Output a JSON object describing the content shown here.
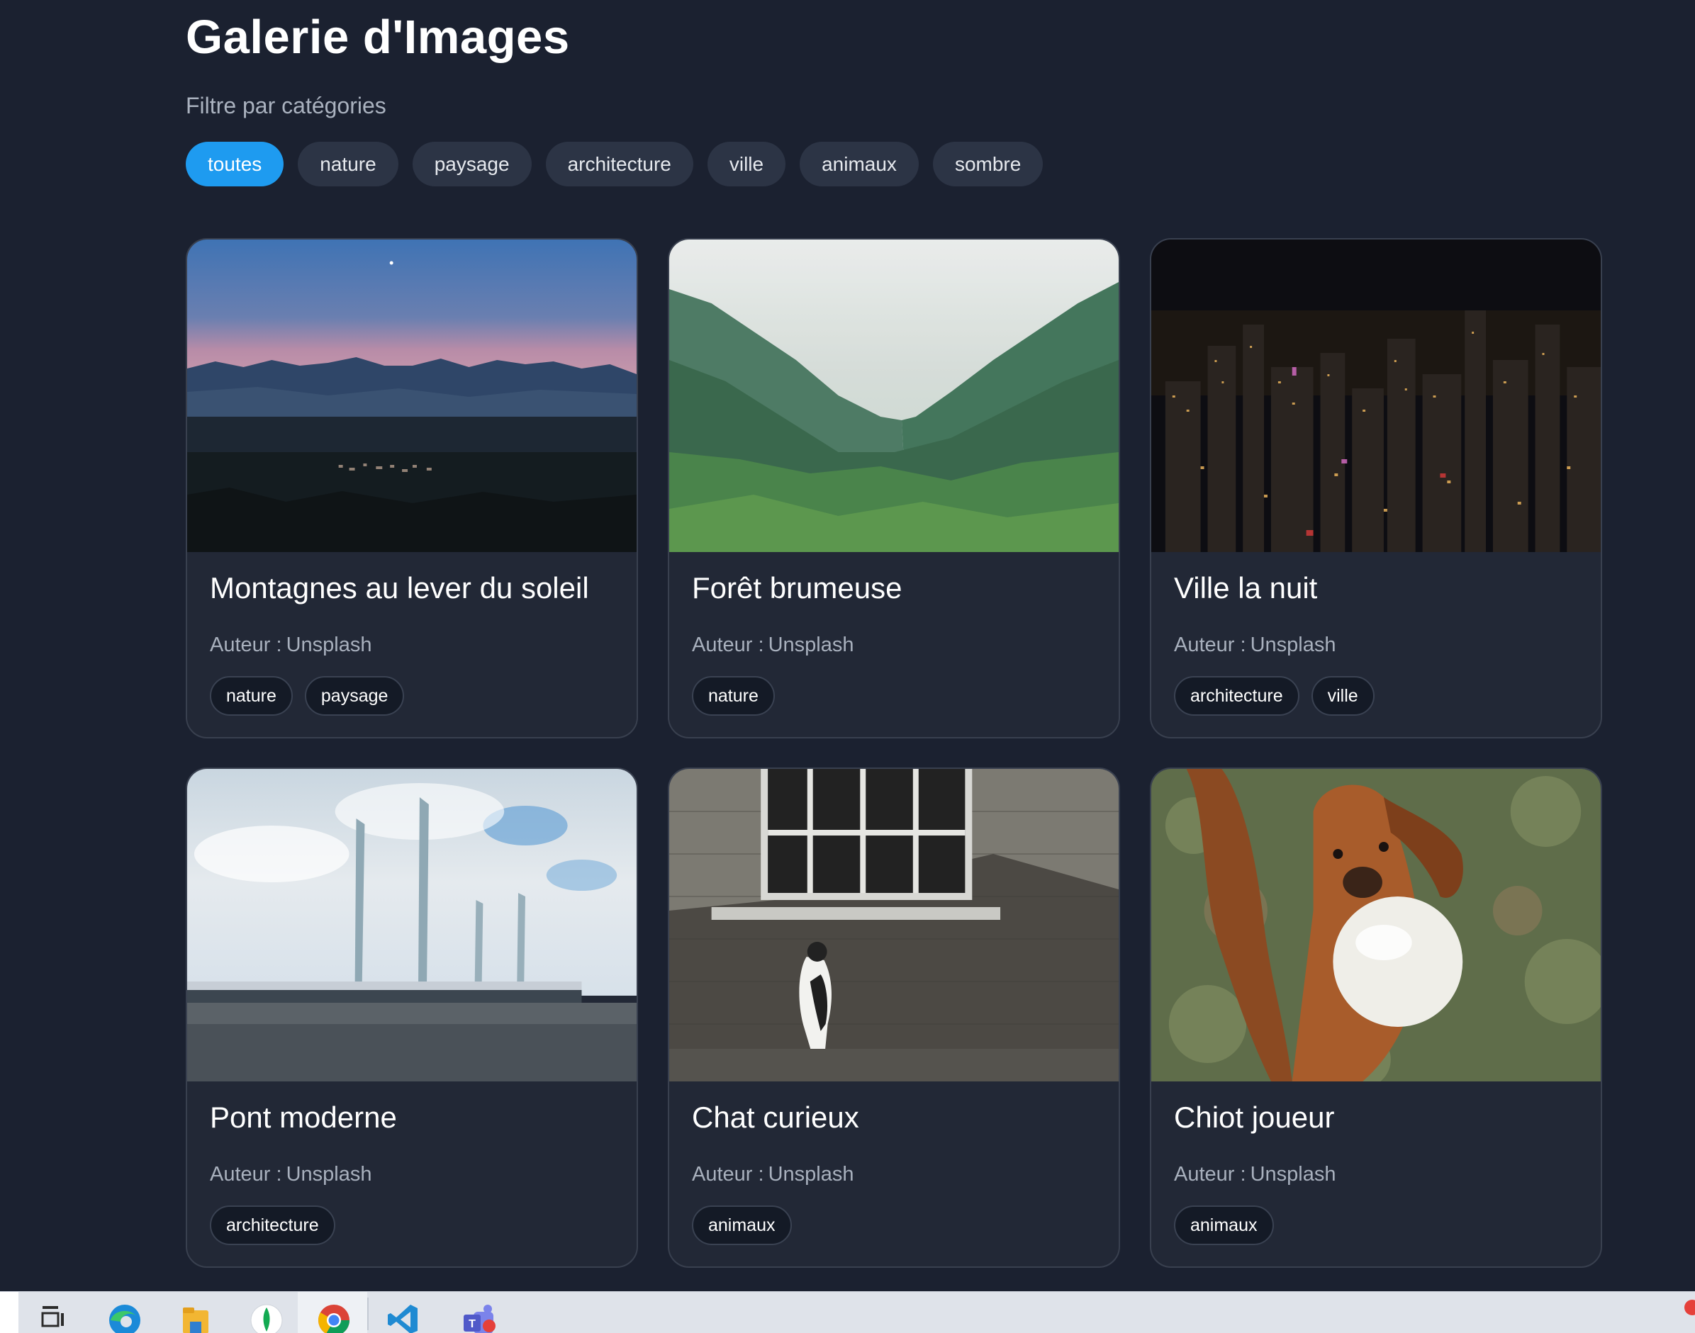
{
  "page": {
    "title": "Galerie d'Images",
    "filter_label": "Filtre par catégories"
  },
  "filters": [
    {
      "label": "toutes",
      "active": true
    },
    {
      "label": "nature",
      "active": false
    },
    {
      "label": "paysage",
      "active": false
    },
    {
      "label": "architecture",
      "active": false
    },
    {
      "label": "ville",
      "active": false
    },
    {
      "label": "animaux",
      "active": false
    },
    {
      "label": "sombre",
      "active": false
    }
  ],
  "cards": [
    {
      "title": "Montagnes au lever du soleil",
      "author_label": "Auteur :",
      "author": "Unsplash",
      "tags": [
        "nature",
        "paysage"
      ],
      "image": "mountains-dusk-photo"
    },
    {
      "title": "Forêt brumeuse",
      "author_label": "Auteur :",
      "author": "Unsplash",
      "tags": [
        "nature"
      ],
      "image": "misty-forest-photo"
    },
    {
      "title": "Ville la nuit",
      "author_label": "Auteur :",
      "author": "Unsplash",
      "tags": [
        "architecture",
        "ville"
      ],
      "image": "city-night-photo"
    },
    {
      "title": "Pont moderne",
      "author_label": "Auteur :",
      "author": "Unsplash",
      "tags": [
        "architecture"
      ],
      "image": "lift-bridge-photo"
    },
    {
      "title": "Chat curieux",
      "author_label": "Auteur :",
      "author": "Unsplash",
      "tags": [
        "animaux"
      ],
      "image": "cat-window-photo"
    },
    {
      "title": "Chiot joueur",
      "author_label": "Auteur :",
      "author": "Unsplash",
      "tags": [
        "animaux"
      ],
      "image": "puppy-ball-photo"
    }
  ],
  "taskbar": {
    "icons": [
      "task-view-icon",
      "edge-browser-icon",
      "file-explorer-icon",
      "mongodb-compass-icon",
      "chrome-browser-icon",
      "vscode-icon",
      "teams-icon"
    ]
  },
  "colors": {
    "background": "#1b2130",
    "card": "#222836",
    "accent": "#1e9bf0",
    "pill": "#2c3445",
    "tag": "#141a26"
  }
}
